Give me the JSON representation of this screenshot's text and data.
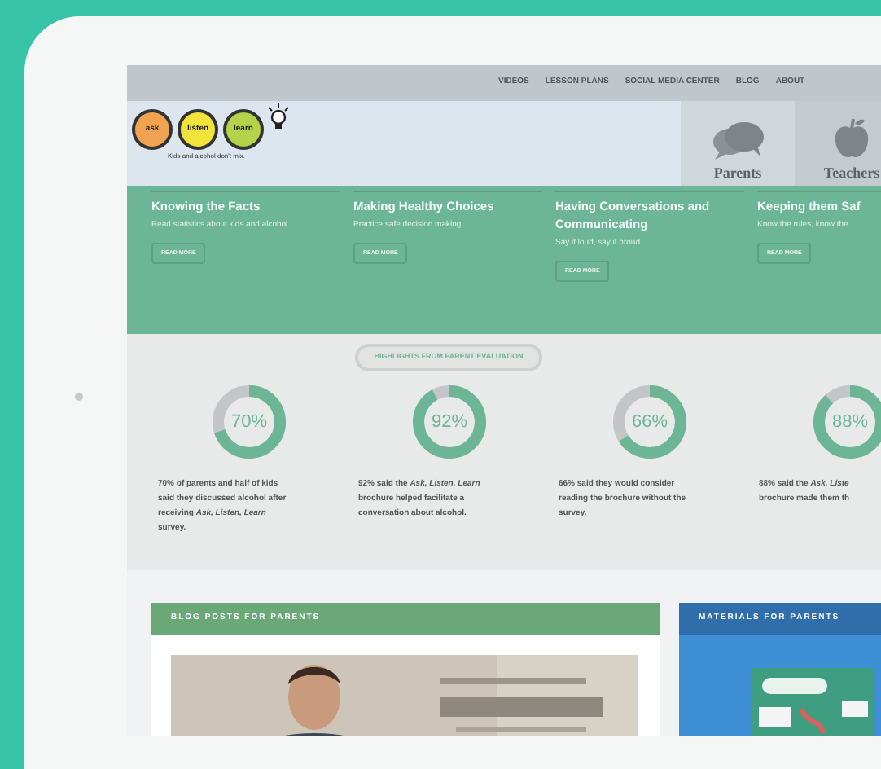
{
  "nav": {
    "links": [
      "VIDEOS",
      "LESSON PLANS",
      "SOCIAL MEDIA CENTER",
      "BLOG",
      "ABOUT"
    ]
  },
  "logo": {
    "words": [
      {
        "text": "ask",
        "color": "#f0a452"
      },
      {
        "text": "listen",
        "color": "#f2e43a"
      },
      {
        "text": "learn",
        "color": "#b5d24a"
      }
    ],
    "tagline": "Kids and alcohol don't mix."
  },
  "audience_tabs": [
    {
      "label": "Parents",
      "kind": "chat",
      "selected": true
    },
    {
      "label": "Teachers",
      "kind": "apple",
      "selected": false
    }
  ],
  "features": [
    {
      "title": "Knowing the Facts",
      "text": "Read statistics about kids and alcohol",
      "button": "READ MORE"
    },
    {
      "title": "Making Healthy Choices",
      "text": "Practice safe decision making",
      "button": "READ MORE"
    },
    {
      "title": "Having Conversations and Communicating",
      "text": "Say it loud, say it proud",
      "button": "READ MORE"
    },
    {
      "title": "Keeping them Saf",
      "text": "Know the rules, know the",
      "button": "READ MORE"
    }
  ],
  "highlights": {
    "label": "HIGHLIGHTS FROM PARENT EVALUATION",
    "stats": [
      {
        "value": "70%",
        "level": 0.7,
        "lines": [
          "70% of parents and half of kids",
          "said they discussed alcohol after",
          "receiving *Ask, Listen, Learn*",
          "survey."
        ]
      },
      {
        "value": "92%",
        "level": 0.92,
        "lines": [
          "92% said the *Ask, Listen, Learn*",
          "brochure helped facilitate a",
          "conversation about alcohol."
        ]
      },
      {
        "value": "66%",
        "level": 0.66,
        "lines": [
          "66% said they would consider",
          "reading the brochure without the",
          "survey."
        ]
      },
      {
        "value": "88%",
        "level": 0.88,
        "lines": [
          "88% said the *Ask, Liste*",
          "brochure made them th"
        ]
      }
    ]
  },
  "panels": [
    {
      "title": "BLOG POSTS FOR PARENTS",
      "kind": "blog"
    },
    {
      "title": "MATERIALS FOR PARENTS",
      "kind": "materials"
    }
  ]
}
